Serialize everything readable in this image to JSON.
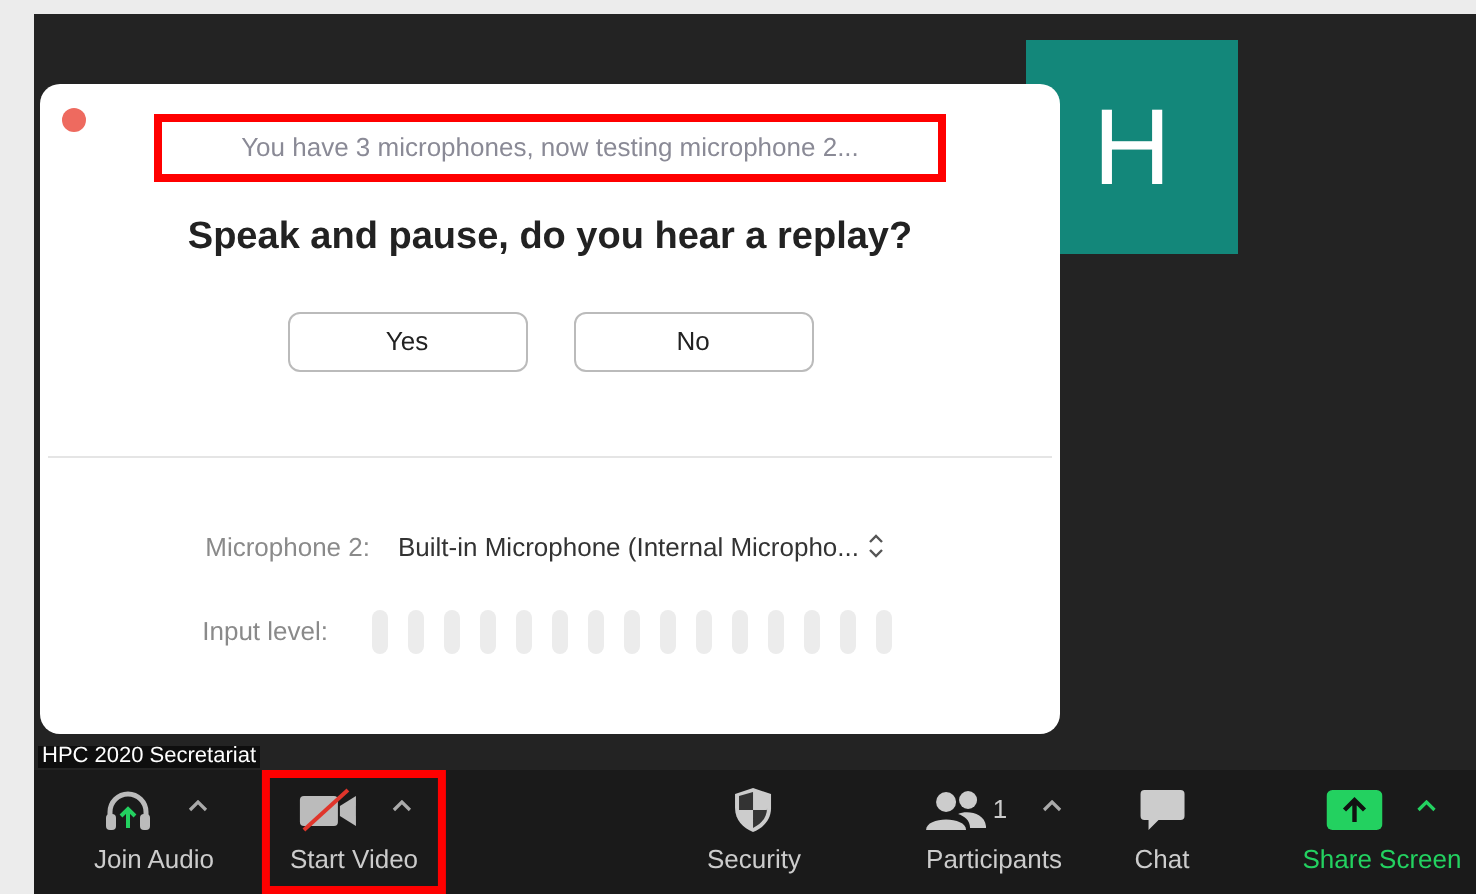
{
  "video_tile": {
    "initial": "H"
  },
  "participant_name": "HPC 2020 Secretariat",
  "dialog": {
    "subtitle": "You have 3 microphones, now testing microphone 2...",
    "subtitle_highlighted": true,
    "title": "Speak and pause, do you hear a replay?",
    "buttons": [
      "Yes",
      "No"
    ],
    "microphone": {
      "label": "Microphone 2:",
      "value": "Built-in Microphone (Internal Micropho..."
    },
    "input_level": {
      "label": "Input level:"
    }
  },
  "toolbar": [
    {
      "kind": "audio",
      "label": "Join Audio",
      "caret": true,
      "highlighted": false
    },
    {
      "kind": "video",
      "label": "Start Video",
      "caret": true,
      "highlighted": true
    },
    {
      "kind": "security",
      "label": "Security",
      "caret": false,
      "highlighted": false
    },
    {
      "kind": "participants",
      "label": "Participants",
      "count": "1",
      "caret": true,
      "highlighted": false
    },
    {
      "kind": "chat",
      "label": "Chat",
      "caret": false,
      "highlighted": false
    },
    {
      "kind": "share",
      "label": "Share Screen",
      "caret": true,
      "highlighted": false
    }
  ]
}
